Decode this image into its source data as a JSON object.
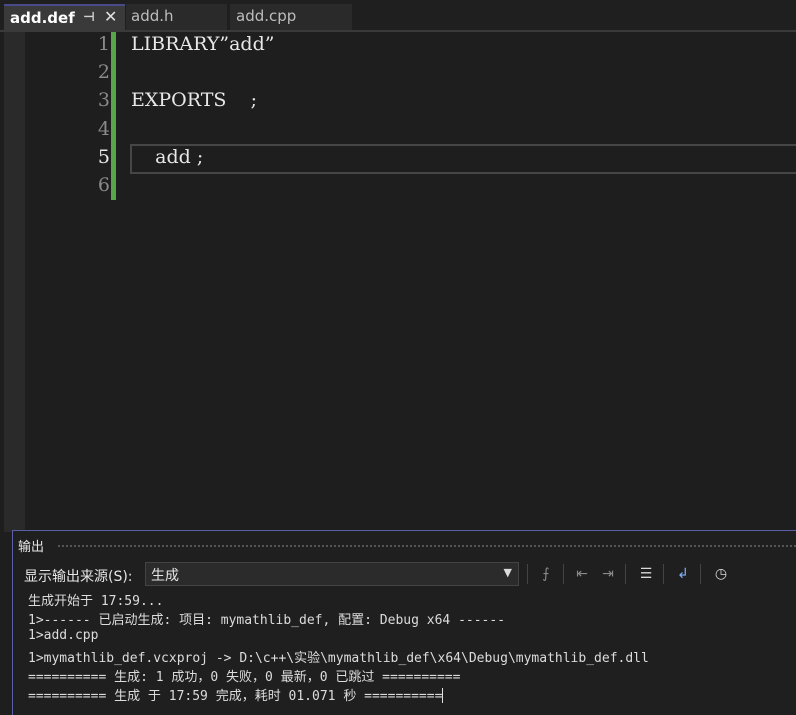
{
  "tabs": [
    {
      "label": "add.def",
      "active": true
    },
    {
      "label": "add.h",
      "active": false
    },
    {
      "label": "add.cpp",
      "active": false
    }
  ],
  "tab_icons": {
    "pin": "pin-icon",
    "close": "close-icon"
  },
  "editor": {
    "line_numbers": [
      "1",
      "2",
      "3",
      "4",
      "5",
      "6"
    ],
    "current_line": "5",
    "lines": [
      "LIBRARY”add”",
      "",
      "EXPORTS    ;",
      "",
      "    add ;",
      ""
    ]
  },
  "output": {
    "title": "输出",
    "source_label": "显示输出来源(S):",
    "source_value": "生成",
    "lines": [
      "生成开始于 17:59...",
      "1>------ 已启动生成: 项目: mymathlib_def, 配置: Debug x64 ------",
      "1>add.cpp",
      "1>mymathlib_def.vcxproj -> D:\\c++\\实验\\mymathlib_def\\x64\\Debug\\mymathlib_def.dll",
      "========== 生成: 1 成功，0 失败，0 最新，0 已跳过 ==========",
      "========== 生成 于 17:59 完成，耗时 01.071 秒 =========="
    ]
  },
  "colors": {
    "change_bar": "#57a64a",
    "panel_border": "#5a5fa8"
  }
}
